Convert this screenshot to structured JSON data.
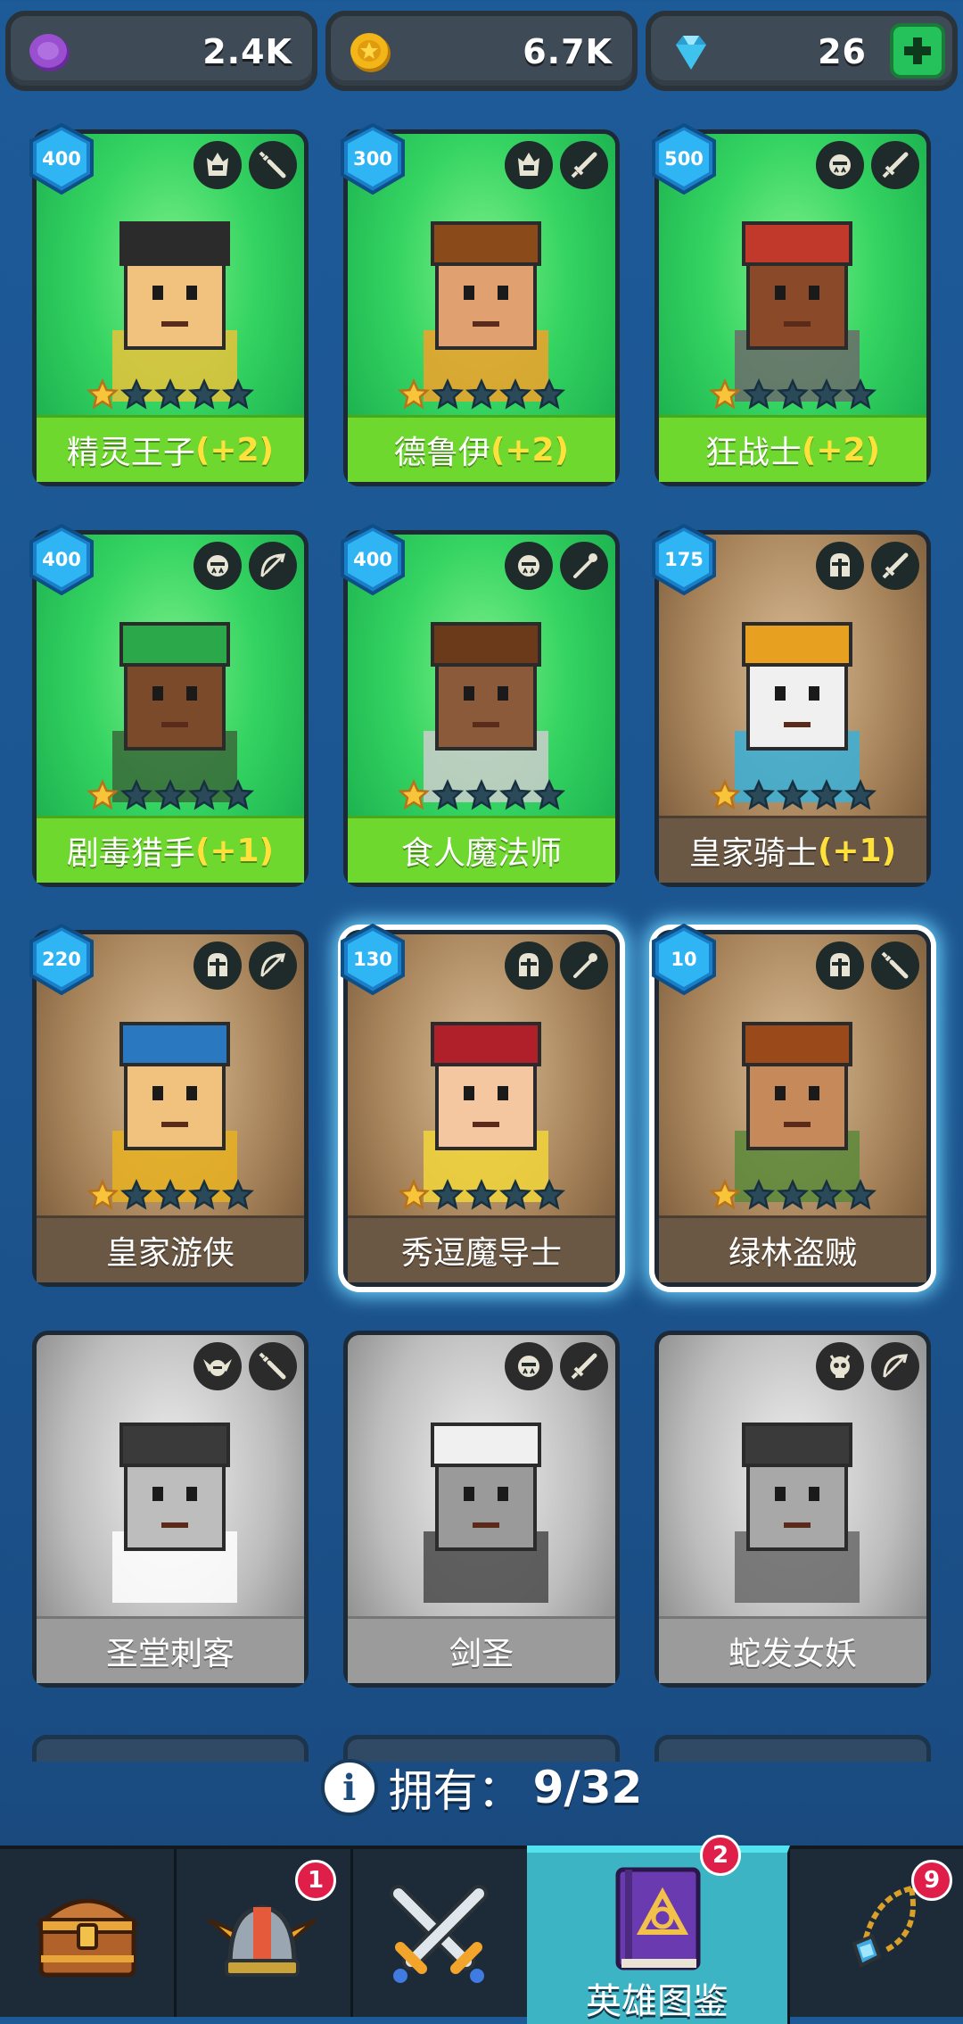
{
  "currencies": [
    {
      "name": "purple-gem",
      "value": "2.4K",
      "color": "#9a4fd1"
    },
    {
      "name": "gold-coin",
      "value": "6.7K",
      "color": "#f2b619"
    },
    {
      "name": "diamond",
      "value": "26",
      "color": "#3fc3ee"
    }
  ],
  "heroes": [
    {
      "name": "精灵王子",
      "bonus": "(+2)",
      "level": "400",
      "stars": 1,
      "style": "green",
      "class_icon": "elf-helm-icon",
      "weapon_icon": "dagger-icon"
    },
    {
      "name": "德鲁伊",
      "bonus": "(+2)",
      "level": "300",
      "stars": 1,
      "style": "green",
      "class_icon": "elf-helm-icon",
      "weapon_icon": "sword-icon"
    },
    {
      "name": "狂战士",
      "bonus": "(+2)",
      "level": "500",
      "stars": 1,
      "style": "green",
      "class_icon": "orc-helm-icon",
      "weapon_icon": "sword-icon"
    },
    {
      "name": "剧毒猎手",
      "bonus": "(+1)",
      "level": "400",
      "stars": 1,
      "style": "green",
      "class_icon": "orc-helm-icon",
      "weapon_icon": "bow-icon"
    },
    {
      "name": "食人魔法师",
      "bonus": "",
      "level": "400",
      "stars": 1,
      "style": "green",
      "class_icon": "orc-helm-icon",
      "weapon_icon": "staff-icon"
    },
    {
      "name": "皇家骑士",
      "bonus": "(+1)",
      "level": "175",
      "stars": 1,
      "style": "brown",
      "class_icon": "knight-helm-icon",
      "weapon_icon": "sword-icon"
    },
    {
      "name": "皇家游侠",
      "bonus": "",
      "level": "220",
      "stars": 1,
      "style": "brown",
      "class_icon": "knight-helm-icon",
      "weapon_icon": "bow-icon"
    },
    {
      "name": "秀逗魔导士",
      "bonus": "",
      "level": "130",
      "stars": 1,
      "style": "brown",
      "class_icon": "knight-helm-icon",
      "weapon_icon": "staff-icon",
      "selected": true
    },
    {
      "name": "绿林盗贼",
      "bonus": "",
      "level": "10",
      "stars": 1,
      "style": "brown",
      "class_icon": "knight-helm-icon",
      "weapon_icon": "dagger-icon",
      "selected": true
    },
    {
      "name": "圣堂刺客",
      "bonus": "",
      "level": "",
      "stars": 0,
      "style": "grey",
      "class_icon": "winged-helm-icon",
      "weapon_icon": "dagger-icon"
    },
    {
      "name": "剑圣",
      "bonus": "",
      "level": "",
      "stars": 0,
      "style": "grey",
      "class_icon": "orc-helm-icon",
      "weapon_icon": "sword-icon"
    },
    {
      "name": "蛇发女妖",
      "bonus": "",
      "level": "",
      "stars": 0,
      "style": "grey",
      "class_icon": "skull-helm-icon",
      "weapon_icon": "bow-icon"
    }
  ],
  "owned": {
    "label": "拥有：",
    "count": "9/32"
  },
  "nav": [
    {
      "name": "shop",
      "icon": "treasure-chest-icon",
      "label": "",
      "badge": ""
    },
    {
      "name": "heroes",
      "icon": "winged-helmet-icon",
      "label": "",
      "badge": "1"
    },
    {
      "name": "battle",
      "icon": "crossed-swords-icon",
      "label": "",
      "badge": ""
    },
    {
      "name": "collection",
      "icon": "spellbook-icon",
      "label": "英雄图鉴",
      "badge": "2",
      "active": true
    },
    {
      "name": "items",
      "icon": "amulet-icon",
      "label": "",
      "badge": "9"
    }
  ]
}
